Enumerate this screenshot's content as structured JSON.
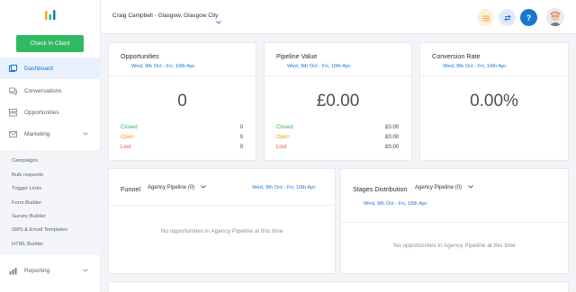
{
  "sidebar": {
    "check_in_label": "Check In Client",
    "nav": [
      {
        "label": "Dashboard"
      },
      {
        "label": "Conversations"
      },
      {
        "label": "Opportunities"
      },
      {
        "label": "Marketing"
      },
      {
        "label": "Reporting"
      }
    ],
    "submenu": [
      "Campaigns",
      "Bulk requests",
      "Trigger Links",
      "Form Builder",
      "Survey Builder",
      "SMS & Email Templates",
      "HTML Builder"
    ]
  },
  "topbar": {
    "location": "Craig Campbell - Glasgow, Glasgow City",
    "help_label": "?"
  },
  "colors": {
    "accent": "#1876d2",
    "green": "#2fba62",
    "sidebar_active": "#e8f1fc"
  },
  "cards": {
    "opportunities": {
      "title": "Opportunities",
      "date": "Wed, 9th Oct - Fri, 10th Apr",
      "value": "0",
      "stats": [
        {
          "label": "Closed",
          "value": "0"
        },
        {
          "label": "Open",
          "value": "0"
        },
        {
          "label": "Lost",
          "value": "0"
        }
      ]
    },
    "pipeline": {
      "title": "Pipeline Value",
      "date": "Wed, 9th Oct - Fri, 10th Apr",
      "value": "£0.00",
      "stats": [
        {
          "label": "Closed",
          "value": "£0.00"
        },
        {
          "label": "Open",
          "value": "£0.00"
        },
        {
          "label": "Lost",
          "value": "£0.00"
        }
      ]
    },
    "conversion": {
      "title": "Conversion Rate",
      "date": "Wed, 9th Oct - Fri, 10th Apr",
      "value": "0.00%"
    },
    "funnel": {
      "title": "Funnel",
      "pipeline": "Agency Pipeline (0)",
      "date": "Wed, 9th Oct - Fri, 10th Apr",
      "empty": "No opportunities in Agency Pipeline at this time"
    },
    "stages": {
      "title": "Stages Distribution",
      "pipeline": "Agency Pipeline (0)",
      "date": "Wed, 9th Oct - Fri, 10th Apr",
      "empty": "No opportunities in Agency Pipeline at this time"
    }
  }
}
